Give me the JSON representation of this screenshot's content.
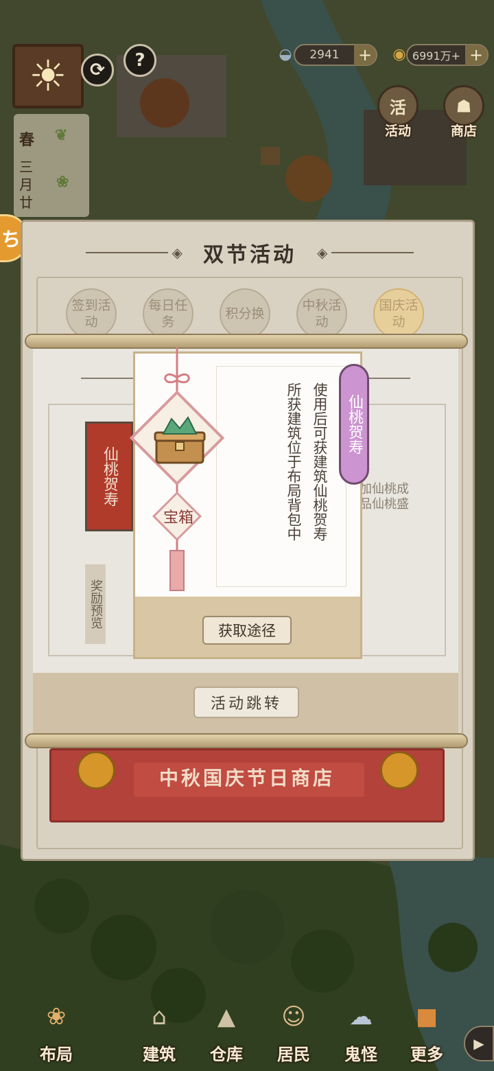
{
  "hud": {
    "help_glyph": "?",
    "refresh_glyph": "⟳",
    "season": "春",
    "date": "三月廿",
    "silver_amount": "2941",
    "coin_amount": "6991万+",
    "plus": "+",
    "activity_icon_char": "活",
    "activity_label": "活动",
    "shop_label": "商店",
    "left_tab_char": "ち"
  },
  "modal": {
    "title": "双节活动",
    "tabs": [
      {
        "label": "签到活动",
        "active": false
      },
      {
        "label": "每日任务",
        "active": false
      },
      {
        "label": "积分换",
        "active": false
      },
      {
        "label": "中秋活动",
        "active": false
      },
      {
        "label": "国庆活动",
        "active": true
      }
    ],
    "banner_text": "仙桃贺寿",
    "reward_preview": "奖励预览",
    "desc_line1": "加仙桃成",
    "desc_line2": "品仙桃盛",
    "jump_button": "活动跳转",
    "shop_banner": "中秋国庆节日商店"
  },
  "item_popup": {
    "name": "仙桃贺寿",
    "type": "宝箱",
    "description_columns": [
      "使用后可获建筑仙桃贺寿",
      "所获建筑位于布局背包中"
    ],
    "get_button": "获取途径"
  },
  "nav": [
    {
      "label": "布局",
      "icon": "layout-icon"
    },
    {
      "label": "建筑",
      "icon": "building-icon"
    },
    {
      "label": "仓库",
      "icon": "warehouse-icon"
    },
    {
      "label": "居民",
      "icon": "resident-icon"
    },
    {
      "label": "鬼怪",
      "icon": "ghost-icon"
    },
    {
      "label": "更多",
      "icon": "more-icon"
    }
  ],
  "colors": {
    "name_tag": "#cc94d0",
    "banner_red": "#b13b2b",
    "modal_bg": "#d9d2c3"
  }
}
